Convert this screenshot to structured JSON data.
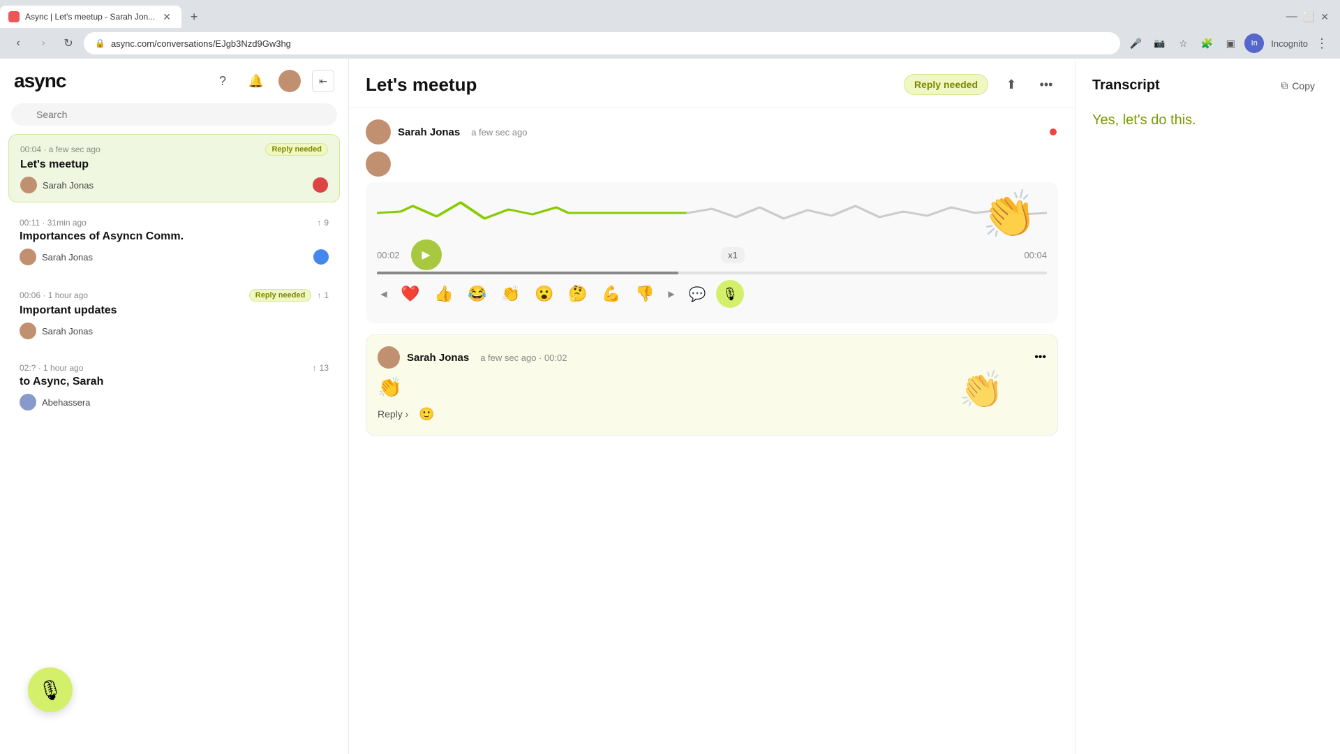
{
  "browser": {
    "tab_title": "Async | Let's meetup - Sarah Jon...",
    "url": "async.com/conversations/EJgb3Nzd9Gw3hg",
    "new_tab_label": "+",
    "nav_back": "‹",
    "nav_forward": "›",
    "nav_refresh": "↻",
    "incognito_label": "Incognito"
  },
  "app": {
    "logo": "async",
    "search_placeholder": "Search"
  },
  "conversations": [
    {
      "duration": "00:04",
      "time": "a few sec ago",
      "badge": "Reply needed",
      "title": "Let's meetup",
      "author": "Sarah Jonas",
      "has_red_dot": true
    },
    {
      "duration": "00:11",
      "time": "31min ago",
      "vote_count": "9",
      "title": "Importances of Asyncn Comm.",
      "author": "Sarah Jonas",
      "has_blue_dot": true
    },
    {
      "duration": "00:06",
      "time": "1 hour ago",
      "badge": "Reply needed",
      "vote_count": "1",
      "title": "Important updates",
      "author": "Sarah Jonas"
    },
    {
      "duration": "02:?",
      "time": "1 hour ago",
      "vote_count": "13",
      "title": "to Async, Sarah",
      "author": "Abehassera"
    }
  ],
  "main": {
    "title": "Let's meetup",
    "reply_needed_label": "Reply needed",
    "share_icon": "⬆",
    "more_icon": "•••",
    "sender_name": "Sarah Jonas",
    "sender_time": "a few sec ago",
    "audio": {
      "current_time": "00:02",
      "end_time": "00:04",
      "speed": "x1"
    },
    "reactions": [
      "❤️",
      "👍",
      "😂",
      "👏",
      "😮",
      "🤔",
      "💪",
      "👎"
    ],
    "clap_emoji": "👏",
    "reply_message": {
      "author": "Sarah Jonas",
      "time": "a few sec ago",
      "duration": "00:02",
      "emoji": "👏",
      "reply_label": "Reply ›",
      "emoji_add_label": "🙂"
    }
  },
  "transcript": {
    "title": "Transcript",
    "copy_label": "Copy",
    "text": "Yes, let's do this."
  },
  "mic_float": "🎙"
}
